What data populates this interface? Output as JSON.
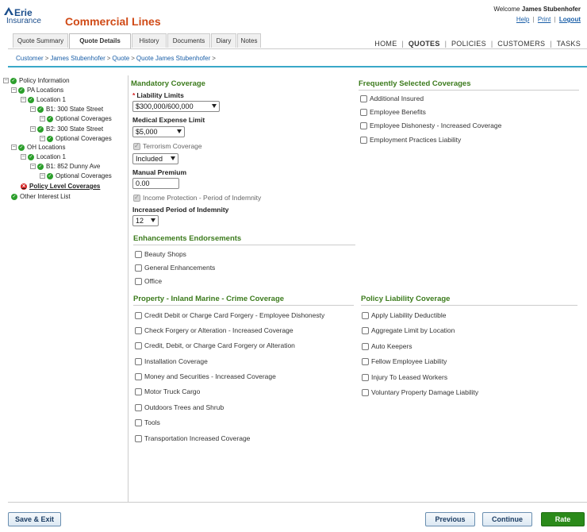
{
  "header": {
    "logo_line1": "Erie",
    "logo_line2": "Insurance",
    "app_title": "Commercial Lines",
    "welcome_prefix": "Welcome",
    "user_name": "James Stubenhofer",
    "links": {
      "help": "Help",
      "print": "Print",
      "logout": "Logout"
    },
    "separator": "|"
  },
  "tabs": [
    "Quote Summary",
    "Quote Details",
    "History",
    "Documents",
    "Diary",
    "Notes"
  ],
  "main_nav": [
    "HOME",
    "QUOTES",
    "POLICIES",
    "CUSTOMERS",
    "TASKS"
  ],
  "breadcrumb": [
    "Customer",
    "James Stubenhofer",
    "Quote",
    "Quote James Stubenhofer"
  ],
  "breadcrumb_sep": ">",
  "tree": [
    {
      "label": "Policy Information",
      "status": "ok"
    },
    {
      "label": "PA Locations",
      "status": "ok"
    },
    {
      "label": "Location 1",
      "status": "ok"
    },
    {
      "label": "B1: 300 State Street",
      "status": "ok"
    },
    {
      "label": "Optional Coverages",
      "status": "ok"
    },
    {
      "label": "B2: 300 State Street",
      "status": "ok"
    },
    {
      "label": "Optional Coverages",
      "status": "ok"
    },
    {
      "label": "OH Locations",
      "status": "ok"
    },
    {
      "label": "Location 1",
      "status": "ok"
    },
    {
      "label": "B1: 852 Dunny Ave",
      "status": "ok"
    },
    {
      "label": "Optional Coverages",
      "status": "ok"
    },
    {
      "label": "Policy Level Coverages",
      "status": "error"
    },
    {
      "label": "Other Interest List",
      "status": "ok"
    }
  ],
  "mandatory": {
    "title": "Mandatory Coverage",
    "liability_label": "Liability Limits",
    "required_mark": "*",
    "liability_value": "$300,000/600,000",
    "medical_label": "Medical Expense Limit",
    "medical_value": "$5,000",
    "terrorism_label": "Terrorism Coverage",
    "terrorism_value": "Included",
    "manual_premium_label": "Manual Premium",
    "manual_premium_value": "0.00",
    "income_label": "Income Protection - Period of Indemnity",
    "increased_period_label": "Increased Period of Indemnity",
    "increased_period_value": "12"
  },
  "frequent": {
    "title": "Frequently Selected Coverages",
    "items": [
      "Additional Insured",
      "Employee Benefits",
      "Employee Dishonesty - Increased Coverage",
      "Employment Practices Liability"
    ]
  },
  "enhancements": {
    "title": "Enhancements Endorsements",
    "items": [
      "Beauty Shops",
      "General Enhancements",
      "Office"
    ]
  },
  "property": {
    "title": "Property - Inland Marine - Crime Coverage",
    "items": [
      "Credit Debit or Charge Card Forgery - Employee Dishonesty",
      "Check Forgery or Alteration - Increased Coverage",
      "Credit, Debit, or Charge Card Forgery or Alteration",
      "Installation Coverage",
      "Money and Securities - Increased Coverage",
      "Motor Truck Cargo",
      "Outdoors Trees and Shrub",
      "Tools",
      "Transportation Increased Coverage"
    ]
  },
  "policy_liability": {
    "title": "Policy Liability Coverage",
    "items": [
      "Apply Liability Deductible",
      "Aggregate Limit by Location",
      "Auto Keepers",
      "Fellow Employee Liability",
      "Injury To Leased Workers",
      "Voluntary Property Damage Liability"
    ]
  },
  "footer": {
    "save_exit": "Save & Exit",
    "previous": "Previous",
    "continue": "Continue",
    "rate": "Rate"
  },
  "colors": {
    "accent_orange": "#d04a16",
    "section_green": "#3c7b1d",
    "link_blue": "#1a5fa8",
    "rate_green": "#2b8a1a",
    "status_ok": "#2b9e2b",
    "status_error": "#d32020"
  }
}
